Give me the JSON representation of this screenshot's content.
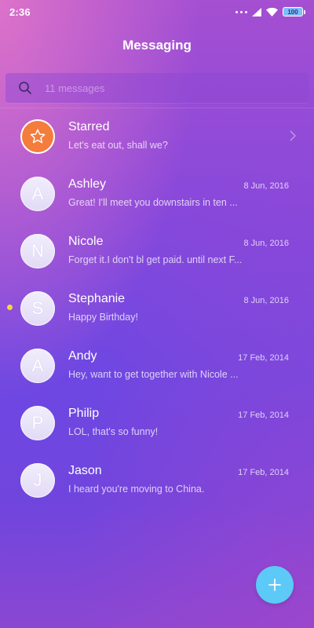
{
  "status_bar": {
    "time": "2:36",
    "battery": "100",
    "icons": [
      "more-dots-icon",
      "signal-icon",
      "wifi-icon",
      "battery-icon"
    ]
  },
  "header": {
    "title": "Messaging"
  },
  "search": {
    "placeholder": "11 messages",
    "icon": "search-icon"
  },
  "conversations": [
    {
      "type": "starred",
      "name": "Starred",
      "preview": "Let's eat out, shall we?",
      "date": "",
      "icon": "star-icon"
    },
    {
      "type": "contact",
      "initial": "A",
      "name": "Ashley",
      "preview": "Great! I'll meet you downstairs in ten ...",
      "date": "8 Jun, 2016",
      "unread": false
    },
    {
      "type": "contact",
      "initial": "N",
      "name": "Nicole",
      "preview": "Forget it.I don't bl get paid. until next F...",
      "date": "8 Jun, 2016",
      "unread": false
    },
    {
      "type": "contact",
      "initial": "S",
      "name": "Stephanie",
      "preview": "Happy Birthday!",
      "date": "8 Jun, 2016",
      "unread": true
    },
    {
      "type": "contact",
      "initial": "A",
      "name": "Andy",
      "preview": "Hey, want to get together with Nicole ...",
      "date": "17 Feb, 2014",
      "unread": false
    },
    {
      "type": "contact",
      "initial": "P",
      "name": "Philip",
      "preview": "LOL, that's so funny!",
      "date": "17 Feb, 2014",
      "unread": false
    },
    {
      "type": "contact",
      "initial": "J",
      "name": "Jason",
      "preview": "I heard you're moving to China.",
      "date": "17 Feb, 2014",
      "unread": false
    }
  ],
  "fab": {
    "icon": "plus-icon"
  },
  "colors": {
    "accent_fab": "#5cc9f7",
    "starred_avatar": "#f47c3c",
    "unread_dot": "#f6d83a"
  }
}
